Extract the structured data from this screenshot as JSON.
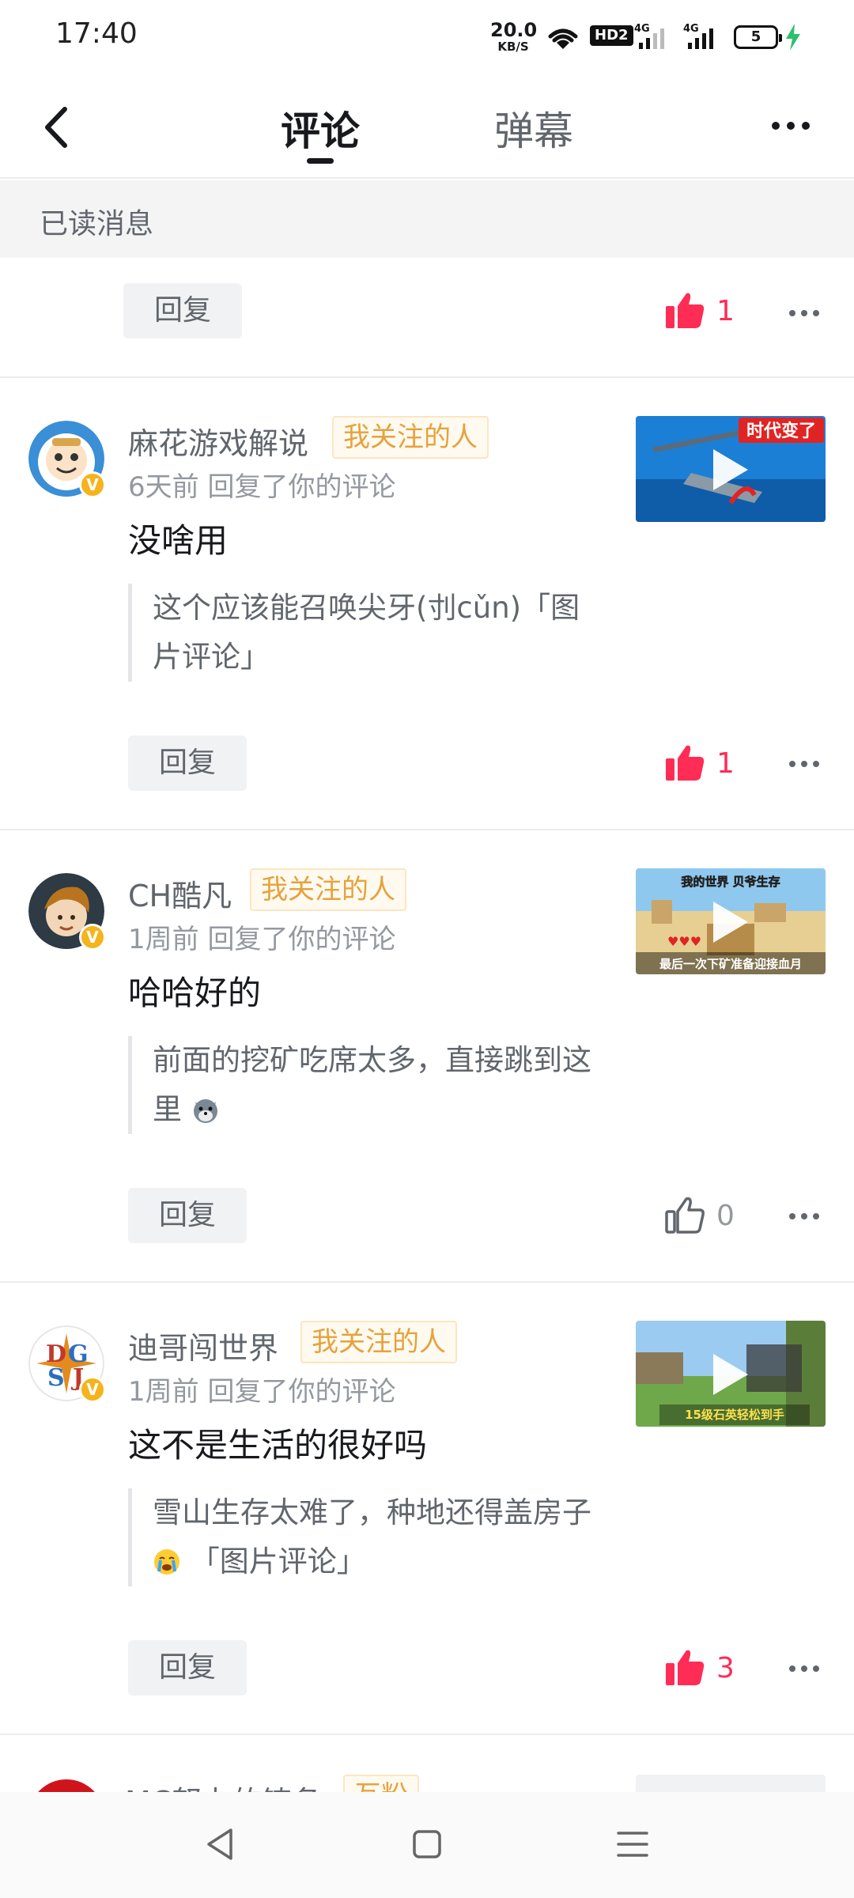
{
  "status_bar": {
    "time": "17:40",
    "net_speed": "20.0",
    "net_unit": "KB/S",
    "hd": "HD2",
    "signal1": "4G",
    "signal2": "4G",
    "battery": "5"
  },
  "header": {
    "tabs": [
      {
        "label": "评论",
        "active": true
      },
      {
        "label": "弹幕",
        "active": false
      }
    ]
  },
  "section": {
    "title": "已读消息"
  },
  "top_card": {
    "reply_label": "回复",
    "likes": "1",
    "liked": true
  },
  "comments": [
    {
      "user": "麻花游戏解说",
      "tag": "我关注的人",
      "meta": "6天前 回复了你的评论",
      "reply": "没啥用",
      "quote": "这个应该能召唤尖牙(刌cǔn)「图片评论」",
      "quote_emoji": "",
      "reply_label": "回复",
      "likes": "1",
      "liked": true,
      "thumb_text": "时代变了"
    },
    {
      "user": "CH酷凡",
      "tag": "我关注的人",
      "meta": "1周前 回复了你的评论",
      "reply": "哈哈好的",
      "quote": "前面的挖矿吃席太多，直接跳到这里",
      "quote_emoji": "wolf-emoji",
      "reply_label": "回复",
      "likes": "0",
      "liked": false,
      "thumb_text": "我的世界 贝爷生存",
      "thumb_text2": "最后一次下矿准备迎接血月"
    },
    {
      "user": "迪哥闯世界",
      "tag": "我关注的人",
      "meta": "1周前 回复了你的评论",
      "reply": "这不是生活的很好吗",
      "quote": "雪山生存太难了，种地还得盖房子",
      "quote_emoji": "crying-emoji",
      "quote_suffix": "「图片评论」",
      "reply_label": "回复",
      "likes": "3",
      "liked": true,
      "thumb_text": "15级石英轻松到手"
    }
  ],
  "partial_card": {
    "user": "MC努力的铸备",
    "tag": "互粉"
  },
  "colors": {
    "like_active": "#ff2c55",
    "follow_tag": "#e6a23c",
    "text_secondary": "#61666d"
  }
}
